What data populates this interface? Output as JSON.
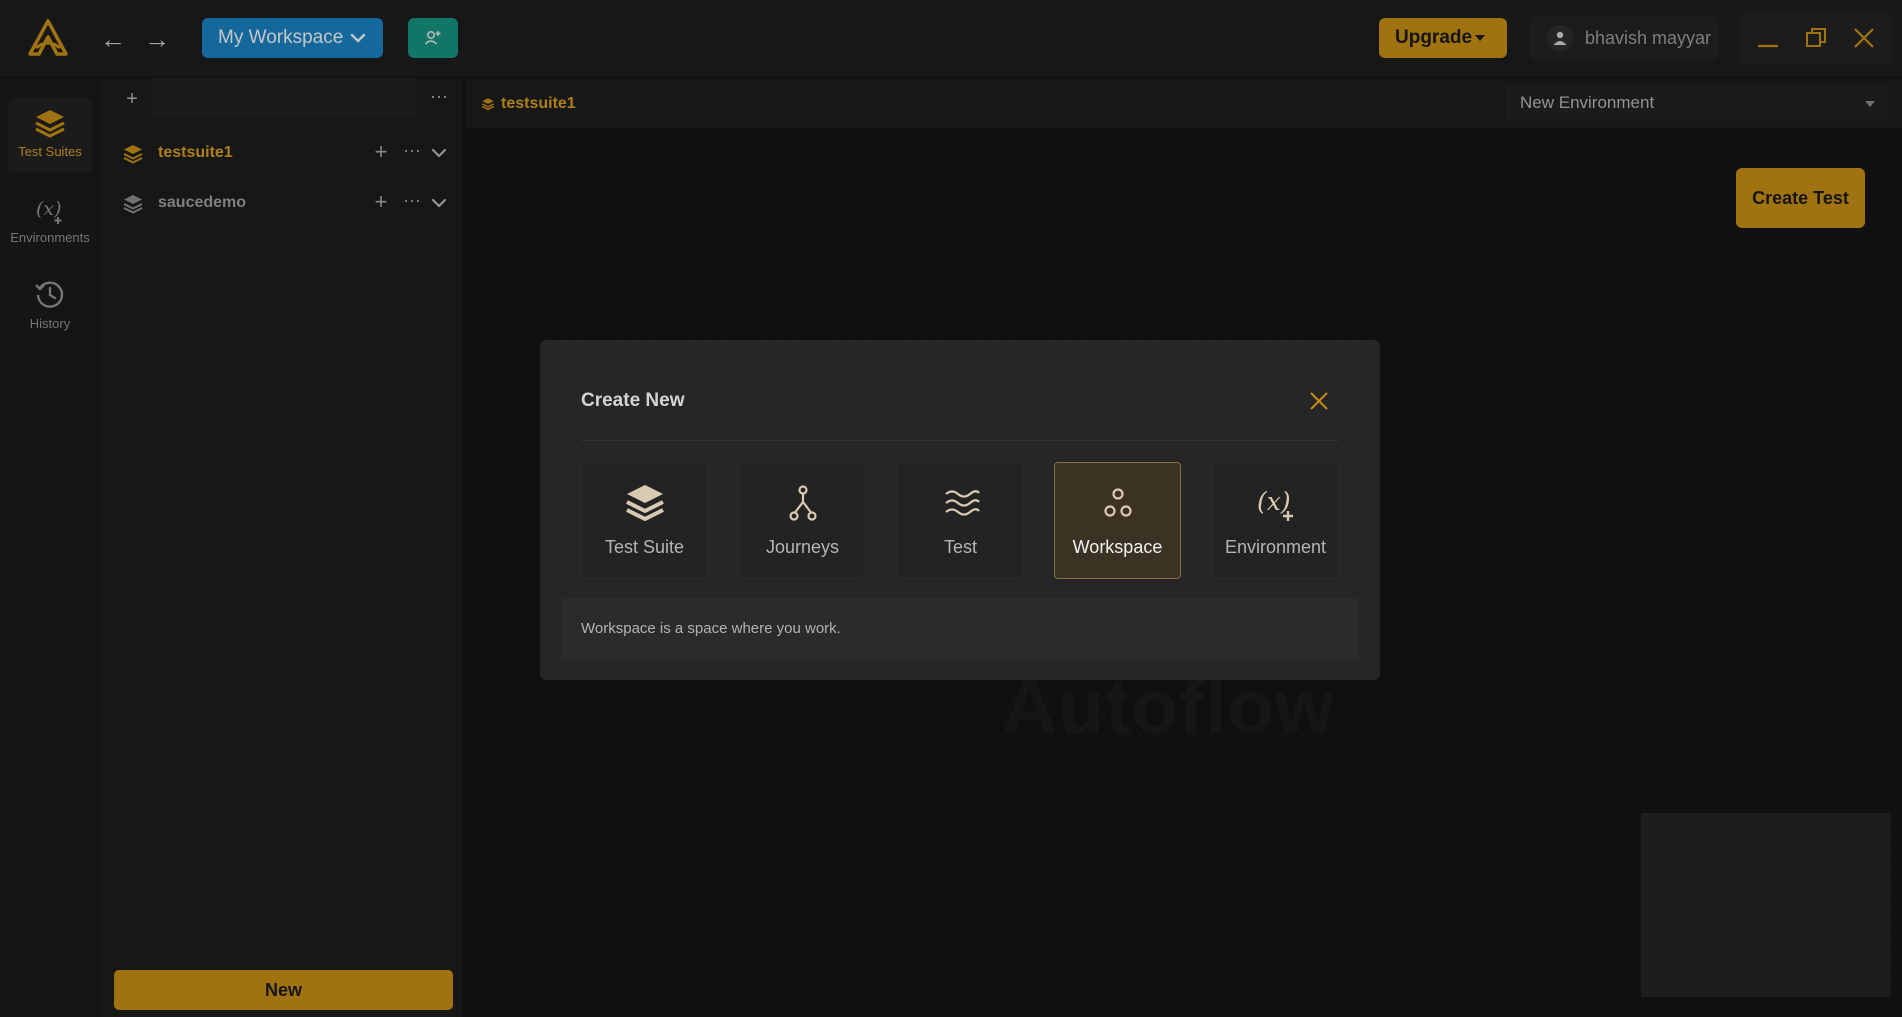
{
  "topbar": {
    "workspace_label": "My Workspace",
    "upgrade_label": "Upgrade",
    "user_name": "bhavish mayyar"
  },
  "rail": {
    "items": [
      {
        "label": "Test Suites",
        "icon": "layers-icon",
        "active": true
      },
      {
        "label": "Environments",
        "icon": "variable-icon",
        "active": false
      },
      {
        "label": "History",
        "icon": "history-icon",
        "active": false
      }
    ]
  },
  "sidebar": {
    "search_value": "",
    "suites": [
      {
        "name": "testsuite1",
        "active": true
      },
      {
        "name": "saucedemo",
        "active": false
      }
    ],
    "new_label": "New"
  },
  "main": {
    "tab_label": "testsuite1",
    "environment_selected": "New Environment",
    "create_test_label": "Create Test",
    "watermark": "Autoflow"
  },
  "modal": {
    "title": "Create New",
    "options": [
      {
        "label": "Test Suite",
        "icon": "layers-icon",
        "selected": false
      },
      {
        "label": "Journeys",
        "icon": "journey-branch-icon",
        "selected": false
      },
      {
        "label": "Test",
        "icon": "waves-icon",
        "selected": false
      },
      {
        "label": "Workspace",
        "icon": "workspace-circles-icon",
        "selected": true
      },
      {
        "label": "Environment",
        "icon": "variable-icon",
        "selected": false
      }
    ],
    "description": "Workspace is a space where you work."
  },
  "colors": {
    "accent": "#c58c14",
    "accent_text": "#d39b22",
    "workspace_button": "#1a7fbf",
    "invite_button": "#17917e",
    "background": "#141414"
  }
}
